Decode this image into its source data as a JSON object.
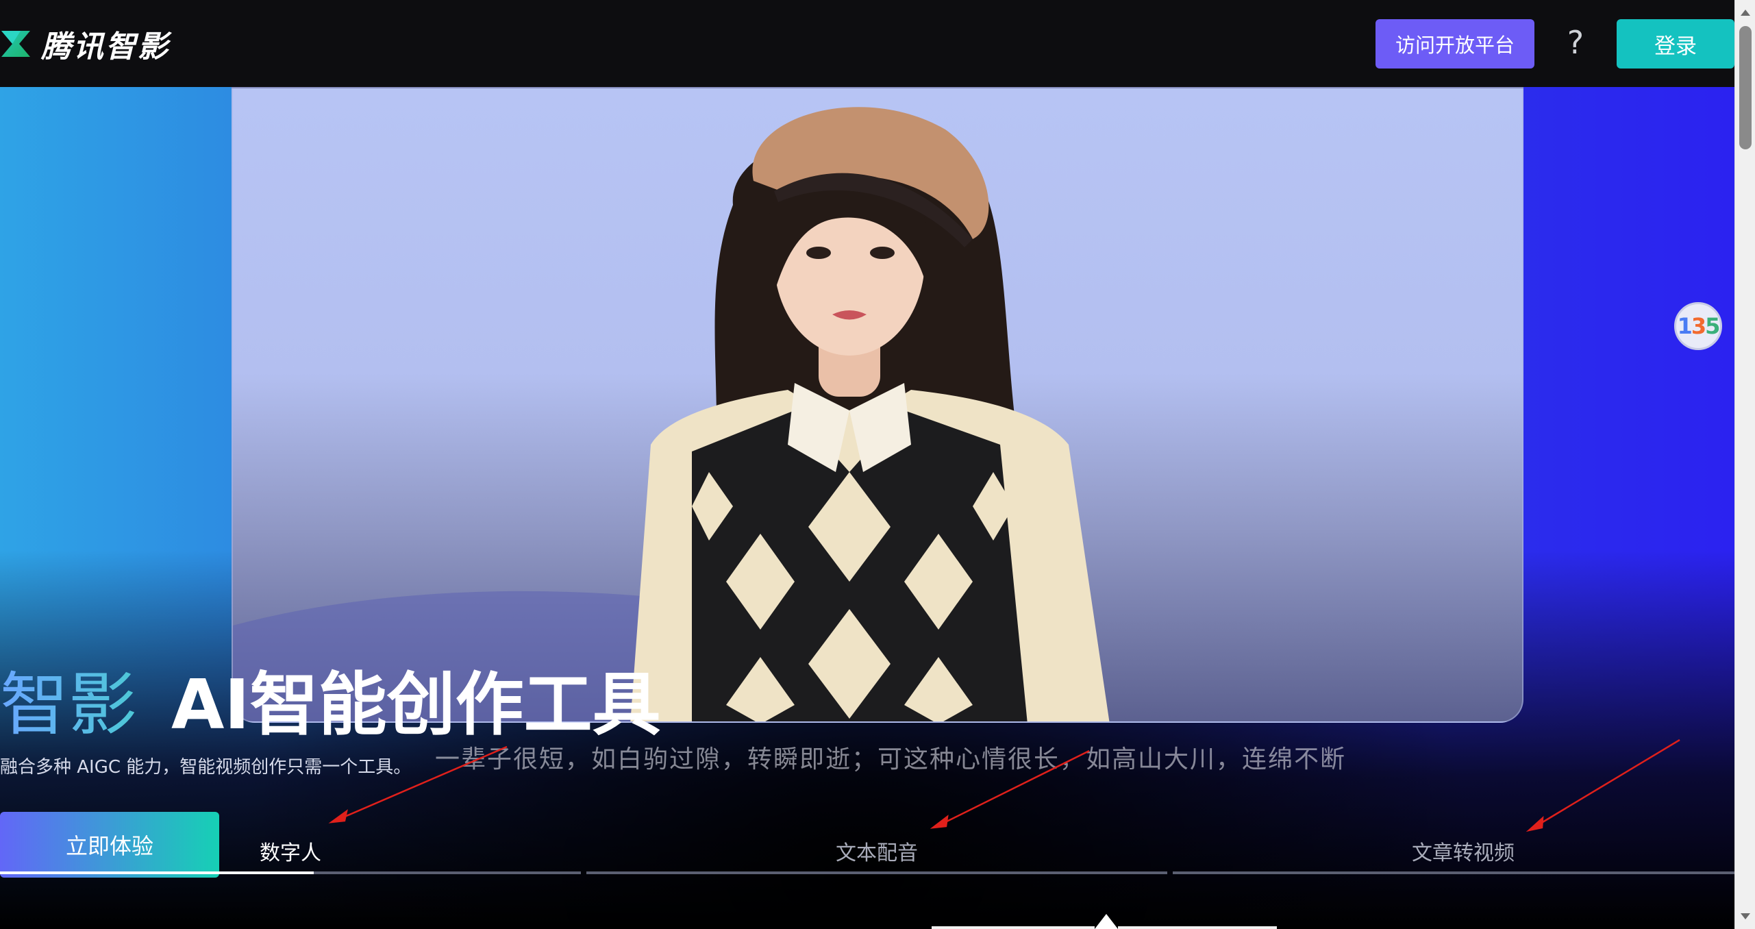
{
  "header": {
    "logo_text": "腾讯智影",
    "platform_button": "访问开放平台",
    "help_label": "?",
    "login_button": "登录"
  },
  "hero": {
    "title_brand": "智影",
    "title_main": "AI智能创作工具",
    "description": "融合多种 AIGC 能力，智能视频创作只需一个工具。",
    "cta_button": "立即体验",
    "video_subtitle": "一辈子很短，如白驹过隙，转瞬即逝；可这种心情很长，如高山大川，连绵不断"
  },
  "tabs": [
    {
      "label": "数字人",
      "active": true,
      "progress": 0.54
    },
    {
      "label": "文本配音",
      "active": false,
      "progress": 0
    },
    {
      "label": "文章转视频",
      "active": false,
      "progress": 0
    }
  ],
  "float_badge": {
    "chars": [
      "1",
      "3",
      "5"
    ]
  },
  "colors": {
    "header_bg": "#0d0d10",
    "platform_button": "#6d5cf6",
    "login_button": "#14c2c0",
    "annotation_arrow": "#e0201b"
  },
  "icons": [
    "logo-icon",
    "help-icon",
    "float-badge-icon",
    "annotation-arrow-icon"
  ]
}
